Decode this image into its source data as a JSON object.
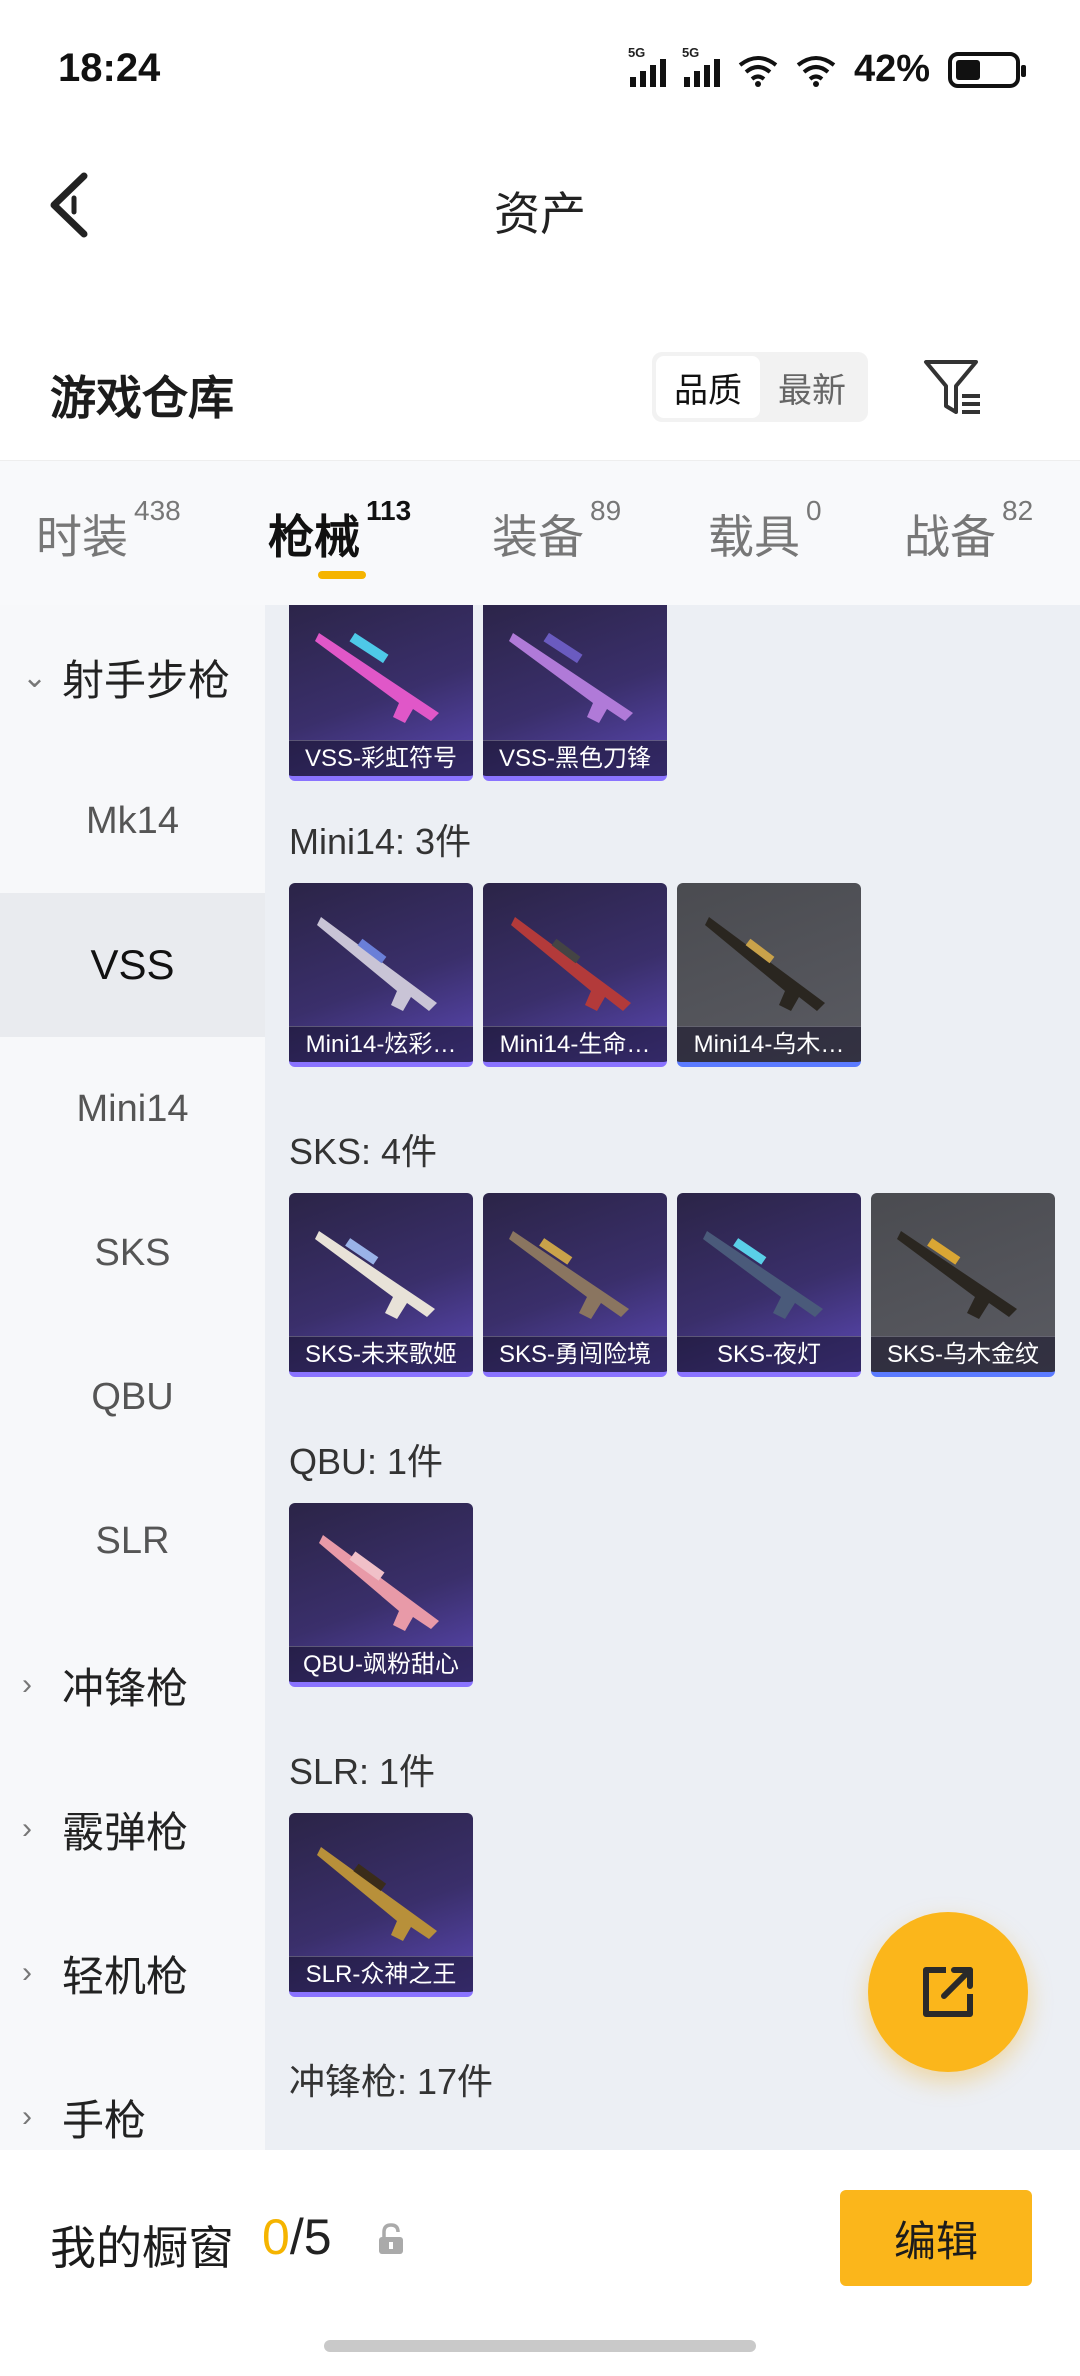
{
  "status": {
    "time": "18:24",
    "battery_pct": "42%",
    "net1": "5G",
    "net2": "5G"
  },
  "nav": {
    "title": "资产"
  },
  "warehouse": {
    "title": "游戏仓库",
    "sort_quality": "品质",
    "sort_newest": "最新"
  },
  "tabs": [
    {
      "label": "时装",
      "count": "438"
    },
    {
      "label": "枪械",
      "count": "113"
    },
    {
      "label": "装备",
      "count": "89"
    },
    {
      "label": "载具",
      "count": "0"
    },
    {
      "label": "战备",
      "count": "82"
    }
  ],
  "sidebar": {
    "sniper": "射手步枪",
    "mk14": "Mk14",
    "vss": "VSS",
    "mini14": "Mini14",
    "sks": "SKS",
    "qbu": "QBU",
    "slr": "SLR",
    "smg": "冲锋枪",
    "shotgun": "霰弹枪",
    "lmg": "轻机枪",
    "pistol": "手枪"
  },
  "sections": {
    "mini14_title": "Mini14: 3件",
    "sks_title": "SKS: 4件",
    "qbu_title": "QBU: 1件",
    "slr_title": "SLR: 1件",
    "smg_title": "冲锋枪: 17件"
  },
  "cards": {
    "vss1": "VSS-彩虹符号",
    "vss2": "VSS-黑色刀锋",
    "mini1": "Mini14-炫彩…",
    "mini2": "Mini14-生命…",
    "mini3": "Mini14-乌木…",
    "sks1": "SKS-未来歌姬",
    "sks2": "SKS-勇闯险境",
    "sks3": "SKS-夜灯",
    "sks4": "SKS-乌木金纹",
    "qbu1": "QBU-飒粉甜心",
    "slr1": "SLR-众神之王"
  },
  "bottom": {
    "showcase_label": "我的橱窗",
    "current": "0",
    "sep_total": "/5",
    "edit_label": "编辑"
  },
  "colors": {
    "accent": "#fbb61b",
    "tab_underline": "#f5b400",
    "card_purple": "#3a2f6b"
  }
}
